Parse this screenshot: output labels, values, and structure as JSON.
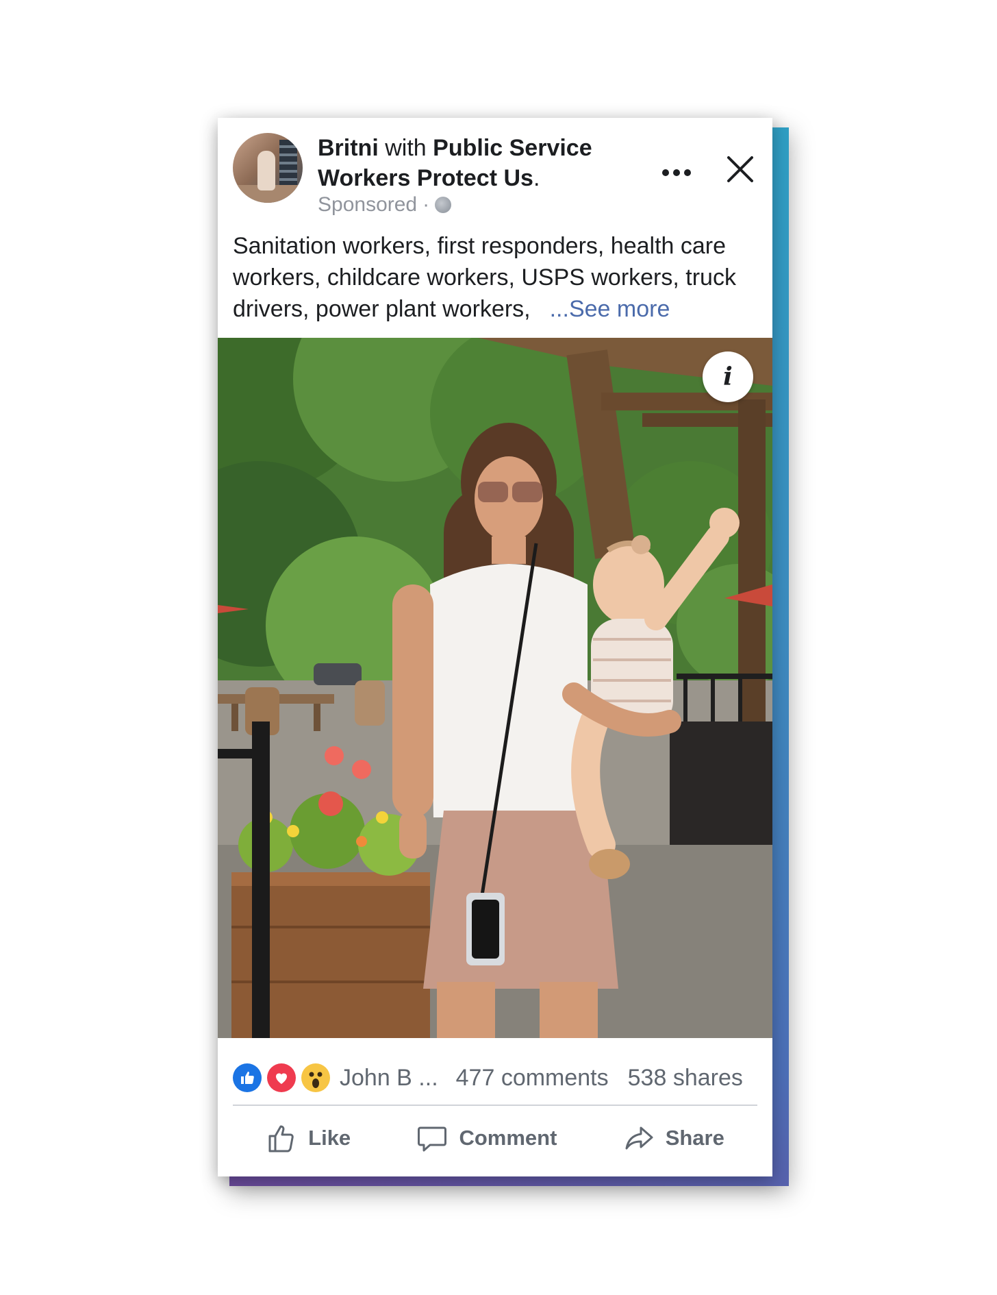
{
  "post": {
    "author": "Britni",
    "with_word": "with",
    "page_name": "Public Service Workers Protect Us",
    "title_end": ".",
    "sponsored": "Sponsored",
    "separator": "·",
    "body": "Sanitation workers, first responders, health care workers, childcare workers, USPS workers, truck drivers, power plant workers,",
    "see_more": "...See more",
    "info_icon_label": "i"
  },
  "stats": {
    "reaction_icons": [
      "like-icon",
      "love-icon",
      "wow-icon"
    ],
    "names": "John B ...",
    "comments": "477 comments",
    "shares": "538 shares"
  },
  "actions": {
    "like": "Like",
    "comment": "Comment",
    "share": "Share"
  },
  "colors": {
    "link_blue": "#4b6bab",
    "like_blue": "#1b74e4",
    "love_red": "#ef3b4f",
    "wow_yellow": "#f7c544",
    "accent_gradient_start": "#2f9fc4",
    "accent_gradient_end": "#6a4a9a"
  }
}
